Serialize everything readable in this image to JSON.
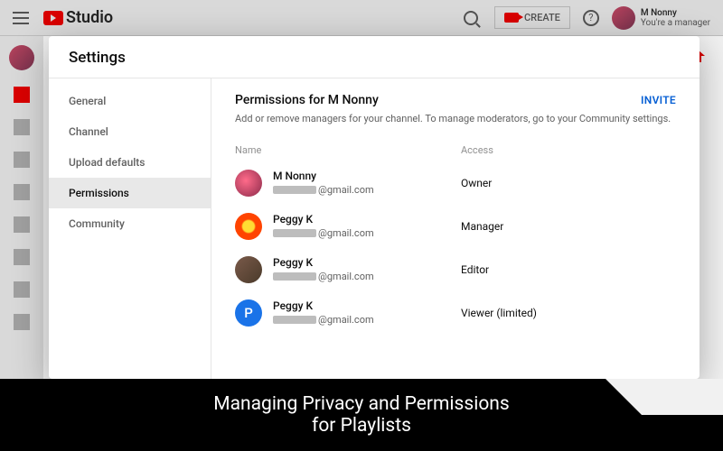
{
  "topbar": {
    "logo_text": "Studio",
    "create_label": "CREATE",
    "account_name": "M Nonny",
    "account_sub": "You're a manager"
  },
  "modal": {
    "title": "Settings",
    "nav": [
      {
        "label": "General"
      },
      {
        "label": "Channel"
      },
      {
        "label": "Upload defaults"
      },
      {
        "label": "Permissions"
      },
      {
        "label": "Community"
      }
    ],
    "panel": {
      "title": "Permissions for M Nonny",
      "invite_label": "INVITE",
      "description": "Add or remove managers for your channel. To manage moderators, go to your Community settings.",
      "col_name": "Name",
      "col_access": "Access",
      "users": [
        {
          "name": "M Nonny",
          "email_suffix": "@gmail.com",
          "access": "Owner",
          "initial": ""
        },
        {
          "name": "Peggy K",
          "email_suffix": "@gmail.com",
          "access": "Manager",
          "initial": ""
        },
        {
          "name": "Peggy K",
          "email_suffix": "@gmail.com",
          "access": "Editor",
          "initial": ""
        },
        {
          "name": "Peggy K",
          "email_suffix": "@gmail.com",
          "access": "Viewer (limited)",
          "initial": "P"
        }
      ]
    }
  },
  "caption": {
    "line1": "Managing Privacy and Permissions",
    "line2": "for Playlists"
  }
}
